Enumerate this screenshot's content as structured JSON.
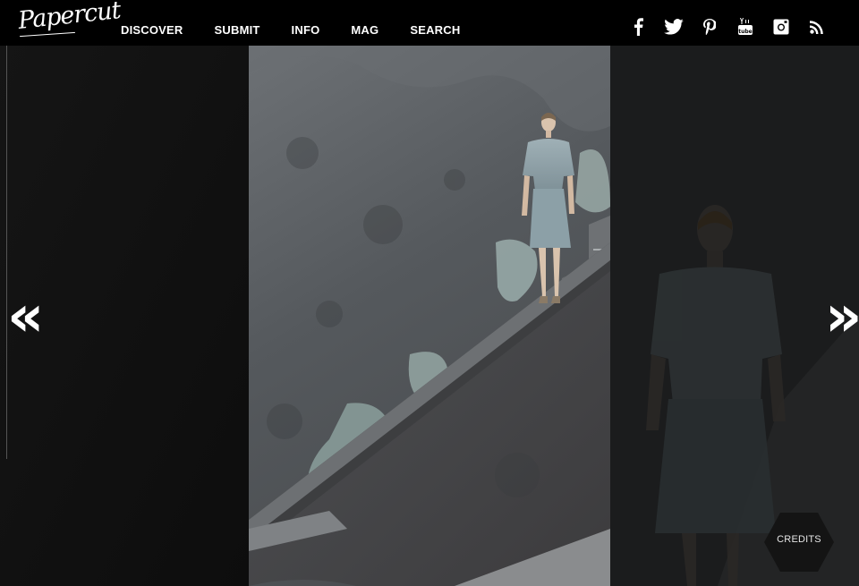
{
  "brand": {
    "logo_text": "Papercut"
  },
  "nav": {
    "items": [
      {
        "label": "DISCOVER"
      },
      {
        "label": "SUBMIT"
      },
      {
        "label": "INFO"
      },
      {
        "label": "MAG"
      },
      {
        "label": "SEARCH"
      }
    ]
  },
  "social": {
    "icons": [
      "facebook-icon",
      "twitter-icon",
      "pinterest-icon",
      "youtube-icon",
      "instagram-icon",
      "rss-icon"
    ],
    "youtube_label": "You"
  },
  "gallery": {
    "prev_label": "«",
    "next_label": "»",
    "credits_label": "CREDITS",
    "photo_description_colors": {
      "wall": "#5d6266",
      "dress": "#8fa1a8",
      "moss": "#9fb3b0"
    }
  }
}
